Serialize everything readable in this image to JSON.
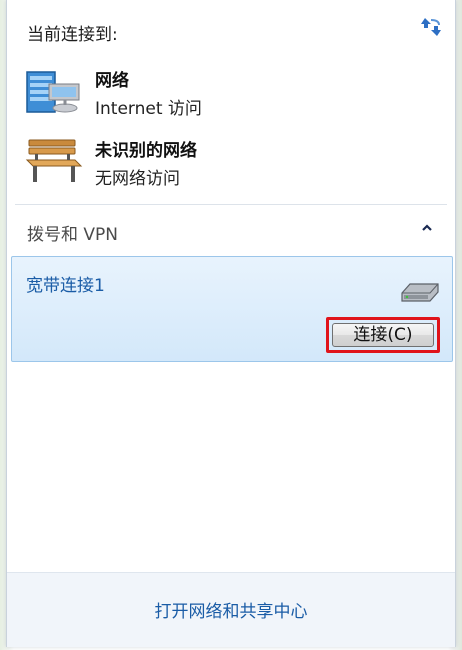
{
  "header": {
    "title": "当前连接到:"
  },
  "networks": [
    {
      "name": "网络",
      "status": "Internet 访问"
    },
    {
      "name": "未识别的网络",
      "status": "无网络访问"
    }
  ],
  "dialup": {
    "section_title": "拨号和 VPN",
    "connection_name": "宽带连接1",
    "connect_label": "连接(C)"
  },
  "footer": {
    "link_label": "打开网络和共享中心"
  },
  "colors": {
    "link_blue": "#1a5ca6",
    "highlight_bg": "#d3e8fa",
    "annotation_red": "#e0141b"
  },
  "icons": {
    "refresh": "refresh-icon",
    "network": "network-computer-icon",
    "unidentified": "bench-icon",
    "collapse": "chevron-up-icon",
    "modem": "modem-icon"
  }
}
